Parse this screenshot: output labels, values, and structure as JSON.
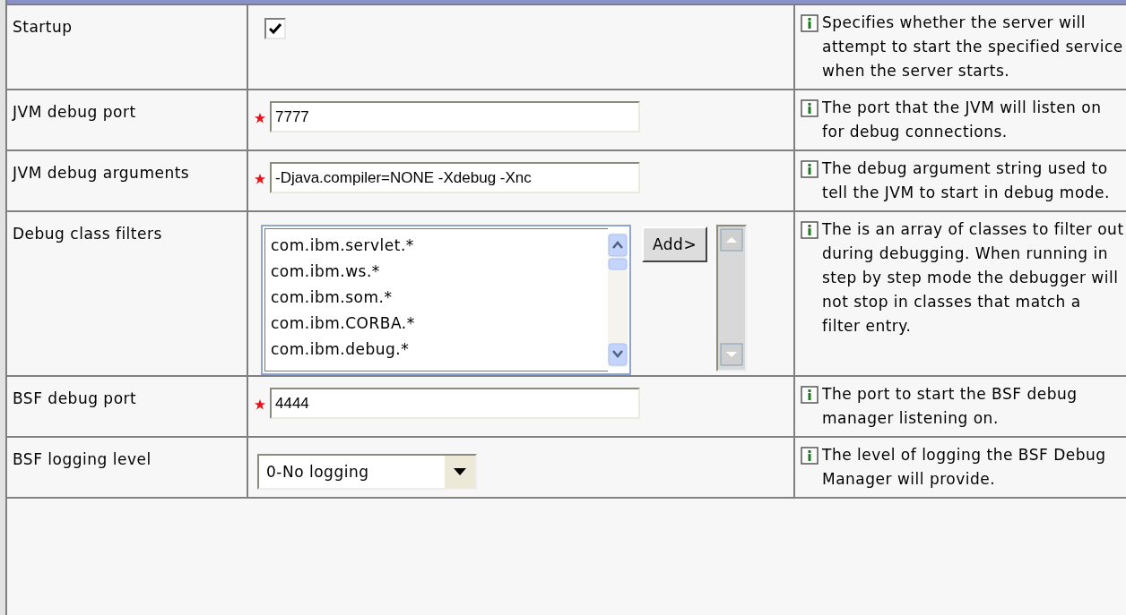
{
  "rows": [
    {
      "label": "Startup",
      "kind": "checkbox",
      "checked": true,
      "description": "Specifies whether the server will attempt to start the specified service when the server starts."
    },
    {
      "label": "JVM debug port",
      "kind": "text",
      "required": true,
      "value": "7777",
      "description": "The port that the JVM will listen on for debug connections."
    },
    {
      "label": "JVM debug arguments",
      "kind": "text",
      "required": true,
      "value": "-Djava.compiler=NONE -Xdebug -Xnc",
      "description": "The debug argument string used to tell the JVM to start in debug mode."
    },
    {
      "label": "Debug class filters",
      "kind": "list",
      "items": [
        "com.ibm.servlet.*",
        "com.ibm.ws.*",
        "com.ibm.som.*",
        "com.ibm.CORBA.*",
        "com.ibm.debug.*"
      ],
      "button": "Add>",
      "description": "The is an array of classes to filter out during debugging. When running in step by step mode the debugger will not stop in classes that match a filter entry."
    },
    {
      "label": "BSF debug port",
      "kind": "text",
      "required": true,
      "value": "4444",
      "description": "The port to start the BSF debug manager listening on."
    },
    {
      "label": "BSF logging level",
      "kind": "select",
      "value": "0-No logging",
      "description": "The level of logging the BSF Debug Manager will provide."
    }
  ]
}
